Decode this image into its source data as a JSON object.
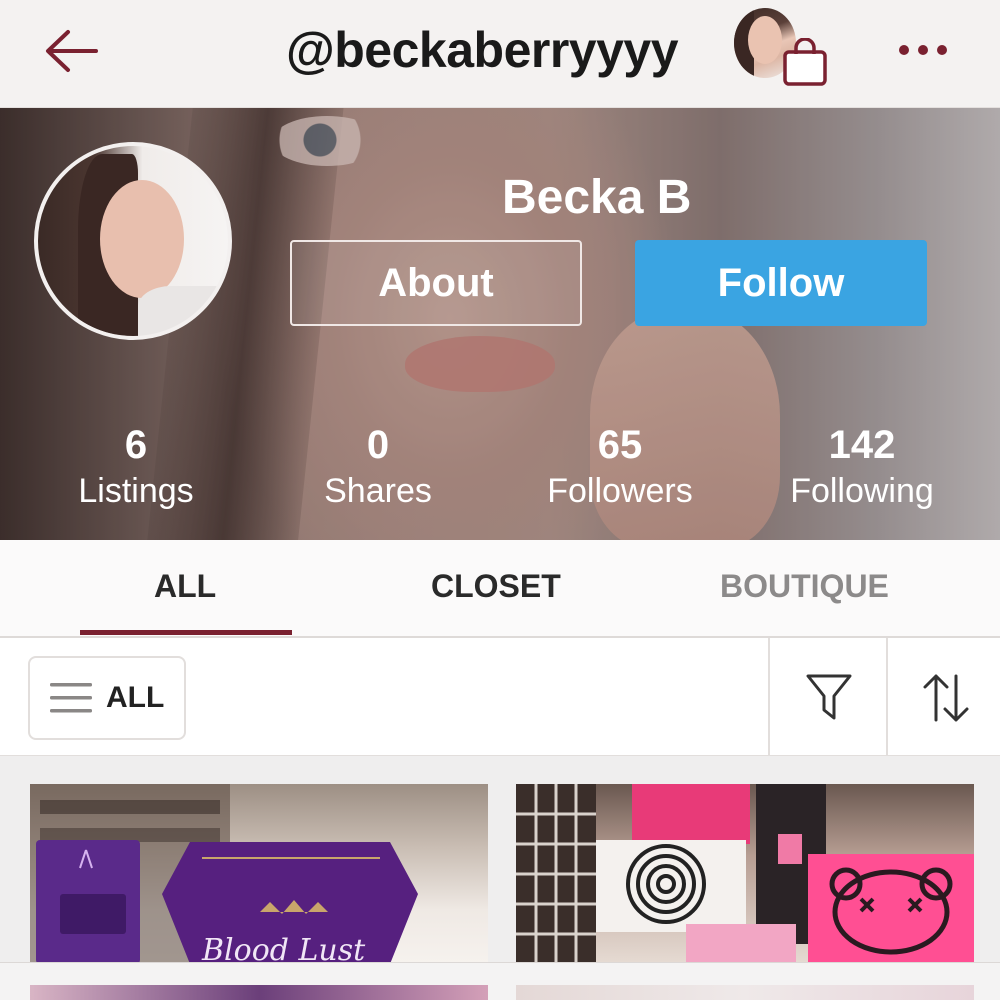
{
  "header": {
    "handle": "@beckaberryyyy",
    "back_icon": "back-arrow-icon",
    "bag_icon": "shopping-bag-icon",
    "more_icon": "more-dots-icon",
    "accent_color": "#7a2130"
  },
  "profile": {
    "name": "Becka B",
    "about_label": "About",
    "follow_label": "Follow",
    "follow_color": "#3aa4e2",
    "stats": [
      {
        "value": "6",
        "label": "Listings"
      },
      {
        "value": "0",
        "label": "Shares"
      },
      {
        "value": "65",
        "label": "Followers"
      },
      {
        "value": "142",
        "label": "Following"
      }
    ]
  },
  "tabs": {
    "items": [
      {
        "label": "ALL",
        "active": true
      },
      {
        "label": "CLOSET",
        "active": false
      },
      {
        "label": "BOUTIQUE",
        "active": false
      }
    ]
  },
  "filter": {
    "category_label": "ALL",
    "menu_icon": "hamburger-icon",
    "filter_icon": "funnel-icon",
    "sort_icon": "sort-arrows-icon"
  },
  "listings": {
    "card1_sign": "Blood Lust",
    "cards": [
      {
        "name": "listing-card"
      },
      {
        "name": "listing-card"
      }
    ]
  }
}
